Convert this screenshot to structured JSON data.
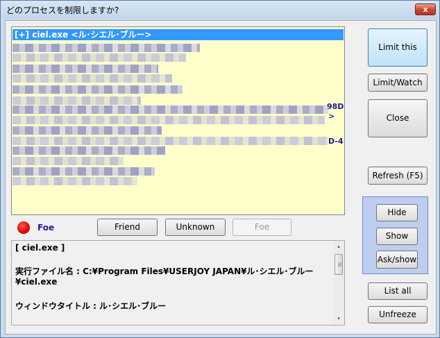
{
  "window": {
    "title": "どのプロセスを制限しますか?",
    "close_glyph": "x"
  },
  "process_list": {
    "selected_item": "[+] ciel.exe <ル･シエル･ブルー>",
    "visible_fragments": [
      "98D",
      ">",
      "D-4"
    ]
  },
  "scrollbar_glyphs": {
    "left": "◂",
    "right": "▸",
    "up": "▴",
    "down": "▾",
    "grip": "III"
  },
  "classification": {
    "current": "Foe",
    "indicator_color": "#e00000",
    "buttons": {
      "friend": "Friend",
      "unknown": "Unknown",
      "foe": "Foe"
    }
  },
  "detail": {
    "lines": [
      "[ ciel.exe ]",
      "実行ファイル名 : C:¥Program Files¥USERJOY JAPAN¥ル･シエル･ブルー",
      "¥ciel.exe",
      "ウィンドウタイトル : ル･シエル･ブルー"
    ]
  },
  "actions": {
    "limit_this": "Limit this",
    "limit_watch": "Limit/Watch",
    "close": "Close",
    "refresh": "Refresh (F5)",
    "hide": "Hide",
    "show": "Show",
    "ask_show": "Ask/show",
    "list_all": "List all",
    "unfreeze": "Unfreeze"
  }
}
